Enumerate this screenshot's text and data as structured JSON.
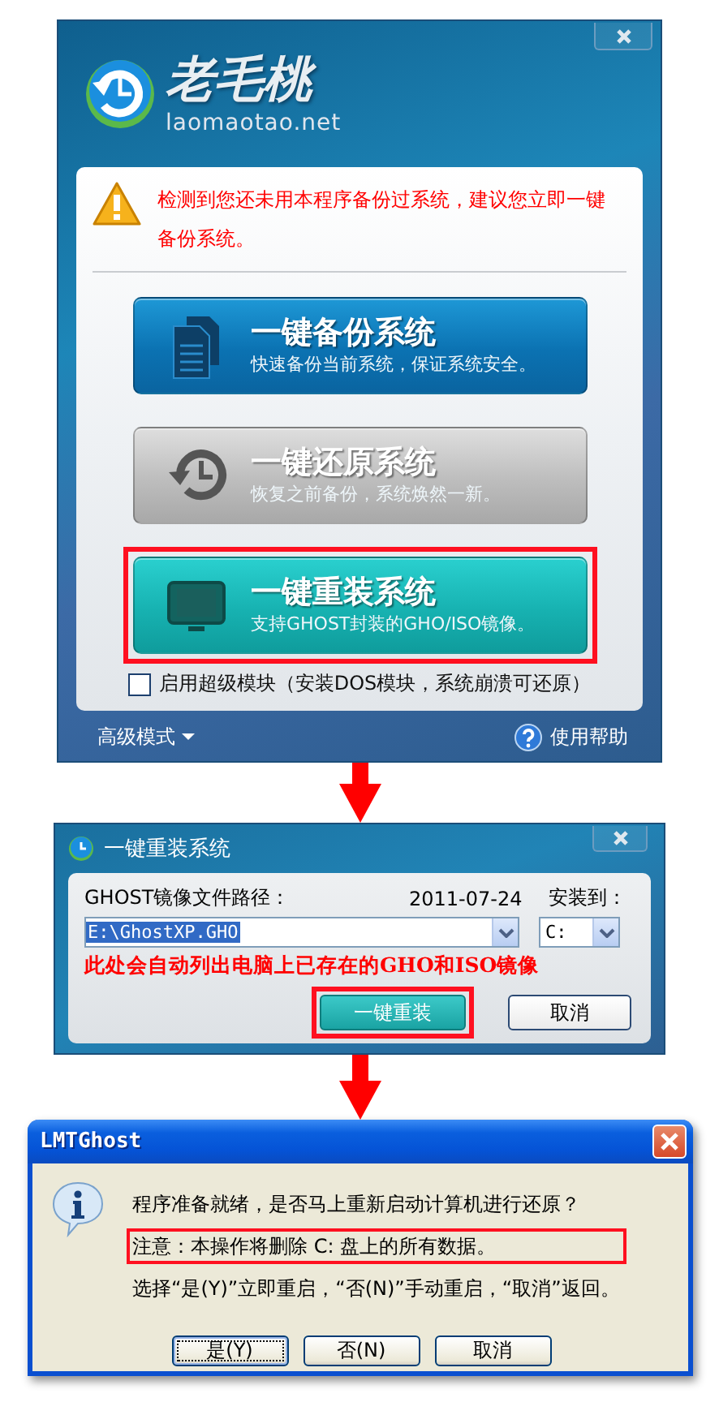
{
  "main_window": {
    "logo_text": "老毛桃",
    "logo_url": "laomaotao.net",
    "warning": "检测到您还未用本程序备份过系统，建议您立即一键备份系统。",
    "actions": [
      {
        "kind": "backup",
        "title": "一键备份系统",
        "subtitle": "快速备份当前系统，保证系统安全。",
        "highlighted": false
      },
      {
        "kind": "restore",
        "title": "一键还原系统",
        "subtitle": "恢复之前备份，系统焕然一新。",
        "highlighted": false
      },
      {
        "kind": "reinstall",
        "title": "一键重装系统",
        "subtitle": "支持GHOST封装的GHO/ISO镜像。",
        "highlighted": true
      }
    ],
    "super_module": {
      "label": "启用超级模块（安装DOS模块，系统崩溃可还原）",
      "checked": false
    },
    "advanced_mode": "高级模式",
    "help": "使用帮助"
  },
  "reinstall_dialog": {
    "title": "一键重装系统",
    "path_label": "GHOST镜像文件路径：",
    "date": "2011-07-24",
    "target_label": "安装到：",
    "path_value": "E:\\GhostXP.GHO",
    "target_value": "C:",
    "note": "此处会自动列出电脑上已存在的GHO和ISO镜像",
    "buttons": [
      {
        "kind": "primary",
        "label": "一键重装",
        "highlighted": true
      },
      {
        "kind": "plain",
        "label": "取消",
        "highlighted": false
      }
    ]
  },
  "confirm_dialog": {
    "title": "LMTGhost",
    "lines": [
      {
        "text": "程序准备就绪，是否马上重新启动计算机进行还原？",
        "highlighted": false
      },
      {
        "text": "注意：本操作将删除 C: 盘上的所有数据。",
        "highlighted": true
      },
      {
        "text": "选择“是(Y)”立即重启，“否(N)”手动重启，“取消”返回。",
        "highlighted": false
      }
    ],
    "buttons": [
      {
        "label": "是(Y)",
        "focused": true
      },
      {
        "label": "否(N)",
        "focused": false
      },
      {
        "label": "取消",
        "focused": false
      }
    ]
  }
}
